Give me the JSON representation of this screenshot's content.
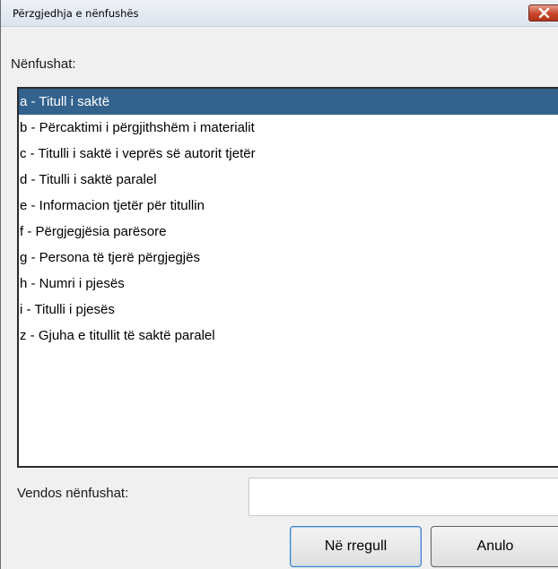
{
  "window": {
    "title": "Përzgjedhja e nënfushës"
  },
  "subfields_label": "Nënfushat:",
  "subfields": [
    {
      "label": "a - Titull i saktë",
      "selected": true
    },
    {
      "label": "b - Përcaktimi i përgjithshëm i materialit",
      "selected": false
    },
    {
      "label": "c - Titulli i saktë i veprës së autorit tjetër",
      "selected": false
    },
    {
      "label": "d - Titulli i saktë paralel",
      "selected": false
    },
    {
      "label": "e - Informacion tjetër për titullin",
      "selected": false
    },
    {
      "label": "f - Përgjegjësia parësore",
      "selected": false
    },
    {
      "label": "g - Persona të tjerë përgjegjës",
      "selected": false
    },
    {
      "label": "h - Numri i pjesës",
      "selected": false
    },
    {
      "label": "i - Titulli i pjesës",
      "selected": false
    },
    {
      "label": "z - Gjuha e titullit të saktë paralel",
      "selected": false
    }
  ],
  "input": {
    "label": "Vendos nënfushat:",
    "value": ""
  },
  "buttons": {
    "ok_label": "Në rregull",
    "cancel_label": "Anulo"
  },
  "colors": {
    "selection": "#33628d",
    "close_button": "#c8452b"
  },
  "icons": {
    "close": "close-icon"
  }
}
